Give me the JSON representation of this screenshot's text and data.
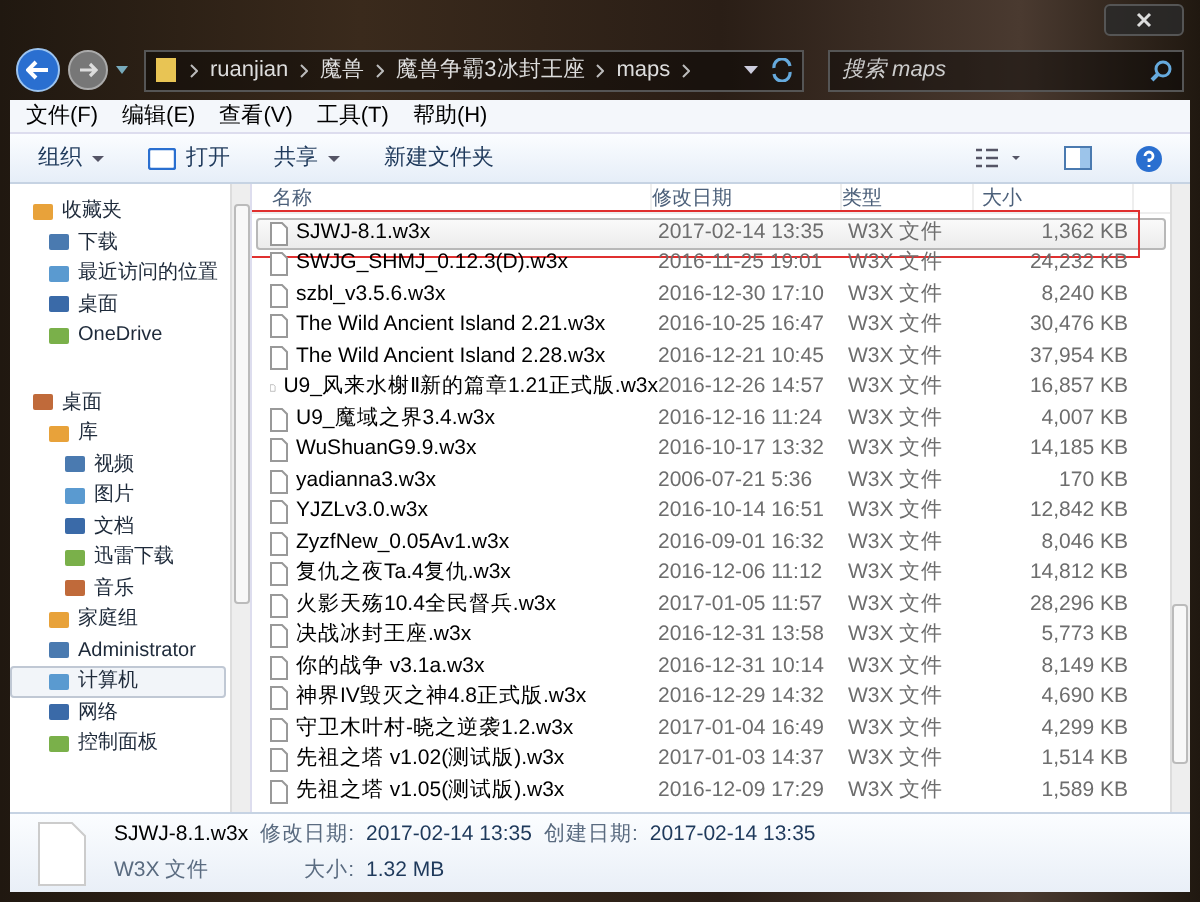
{
  "address": {
    "segments": [
      "ruanjian",
      "魔兽",
      "魔兽争霸3冰封王座",
      "maps"
    ]
  },
  "search": {
    "placeholder": "搜索 maps"
  },
  "menu": [
    "文件(F)",
    "编辑(E)",
    "查看(V)",
    "工具(T)",
    "帮助(H)"
  ],
  "toolbar": [
    {
      "label": "组织",
      "kind": "dropdown"
    },
    {
      "label": "打开",
      "kind": "open"
    },
    {
      "label": "共享",
      "kind": "dropdown"
    },
    {
      "label": "新建文件夹",
      "kind": "plain"
    }
  ],
  "sidebar": {
    "groups": [
      {
        "label": "收藏夹",
        "selected": false,
        "children": [
          {
            "label": "下载",
            "selected": false
          },
          {
            "label": "最近访问的位置",
            "selected": false
          },
          {
            "label": "桌面",
            "selected": false
          },
          {
            "label": "OneDrive",
            "selected": false
          }
        ]
      },
      {
        "label": "桌面",
        "selected": false,
        "children": [
          {
            "label": "库",
            "selected": false,
            "children": [
              {
                "label": "视频",
                "selected": false
              },
              {
                "label": "图片",
                "selected": false
              },
              {
                "label": "文档",
                "selected": false
              },
              {
                "label": "迅雷下载",
                "selected": false
              },
              {
                "label": "音乐",
                "selected": false
              }
            ]
          },
          {
            "label": "家庭组",
            "selected": false
          },
          {
            "label": "Administrator",
            "selected": false
          },
          {
            "label": "计算机",
            "selected": true
          },
          {
            "label": "网络",
            "selected": false
          },
          {
            "label": "控制面板",
            "selected": false
          }
        ]
      }
    ]
  },
  "table": {
    "columns": [
      "名称",
      "修改日期",
      "类型",
      "大小"
    ],
    "rows": [
      {
        "name": "SJWJ-8.1.w3x",
        "date": "2017-02-14 13:35",
        "type": "W3X 文件",
        "size": "1,362 KB",
        "selected": true,
        "annotated": true
      },
      {
        "name": "SWJG_SHMJ_0.12.3(D).w3x",
        "date": "2016-11-25 19:01",
        "type": "W3X 文件",
        "size": "24,232 KB",
        "selected": false,
        "annotated": false
      },
      {
        "name": "szbl_v3.5.6.w3x",
        "date": "2016-12-30 17:10",
        "type": "W3X 文件",
        "size": "8,240 KB",
        "selected": false,
        "annotated": false
      },
      {
        "name": "The Wild Ancient Island 2.21.w3x",
        "date": "2016-10-25 16:47",
        "type": "W3X 文件",
        "size": "30,476 KB",
        "selected": false,
        "annotated": false
      },
      {
        "name": "The Wild Ancient Island 2.28.w3x",
        "date": "2016-12-21 10:45",
        "type": "W3X 文件",
        "size": "37,954 KB",
        "selected": false,
        "annotated": false
      },
      {
        "name": "U9_风来水榭Ⅱ新的篇章1.21正式版.w3x",
        "date": "2016-12-26 14:57",
        "type": "W3X 文件",
        "size": "16,857 KB",
        "selected": false,
        "annotated": false
      },
      {
        "name": "U9_魔域之界3.4.w3x",
        "date": "2016-12-16 11:24",
        "type": "W3X 文件",
        "size": "4,007 KB",
        "selected": false,
        "annotated": false
      },
      {
        "name": "WuShuanG9.9.w3x",
        "date": "2016-10-17 13:32",
        "type": "W3X 文件",
        "size": "14,185 KB",
        "selected": false,
        "annotated": false
      },
      {
        "name": "yadianna3.w3x",
        "date": "2006-07-21 5:36",
        "type": "W3X 文件",
        "size": "170 KB",
        "selected": false,
        "annotated": false
      },
      {
        "name": "YJZLv3.0.w3x",
        "date": "2016-10-14 16:51",
        "type": "W3X 文件",
        "size": "12,842 KB",
        "selected": false,
        "annotated": false
      },
      {
        "name": "ZyzfNew_0.05Av1.w3x",
        "date": "2016-09-01 16:32",
        "type": "W3X 文件",
        "size": "8,046 KB",
        "selected": false,
        "annotated": false
      },
      {
        "name": "复仇之夜Ta.4复仇.w3x",
        "date": "2016-12-06 11:12",
        "type": "W3X 文件",
        "size": "14,812 KB",
        "selected": false,
        "annotated": false
      },
      {
        "name": "火影天殇10.4全民督兵.w3x",
        "date": "2017-01-05 11:57",
        "type": "W3X 文件",
        "size": "28,296 KB",
        "selected": false,
        "annotated": false
      },
      {
        "name": "决战冰封王座.w3x",
        "date": "2016-12-31 13:58",
        "type": "W3X 文件",
        "size": "5,773 KB",
        "selected": false,
        "annotated": false
      },
      {
        "name": "你的战争 v3.1a.w3x",
        "date": "2016-12-31 10:14",
        "type": "W3X 文件",
        "size": "8,149 KB",
        "selected": false,
        "annotated": false
      },
      {
        "name": "神界IV毁灭之神4.8正式版.w3x",
        "date": "2016-12-29 14:32",
        "type": "W3X 文件",
        "size": "4,690 KB",
        "selected": false,
        "annotated": false
      },
      {
        "name": "守卫木叶村-晓之逆袭1.2.w3x",
        "date": "2017-01-04 16:49",
        "type": "W3X 文件",
        "size": "4,299 KB",
        "selected": false,
        "annotated": false
      },
      {
        "name": "先祖之塔 v1.02(测试版).w3x",
        "date": "2017-01-03 14:37",
        "type": "W3X 文件",
        "size": "1,514 KB",
        "selected": false,
        "annotated": false
      },
      {
        "name": "先祖之塔 v1.05(测试版).w3x",
        "date": "2016-12-09 17:29",
        "type": "W3X 文件",
        "size": "1,589 KB",
        "selected": false,
        "annotated": false
      }
    ]
  },
  "details": {
    "name": "SJWJ-8.1.w3x",
    "type": "W3X 文件",
    "fields": [
      {
        "label": "修改日期:",
        "value": "2017-02-14 13:35"
      },
      {
        "label": "大小:",
        "value": "1.32 MB"
      },
      {
        "label": "创建日期:",
        "value": "2017-02-14 13:35"
      }
    ]
  }
}
